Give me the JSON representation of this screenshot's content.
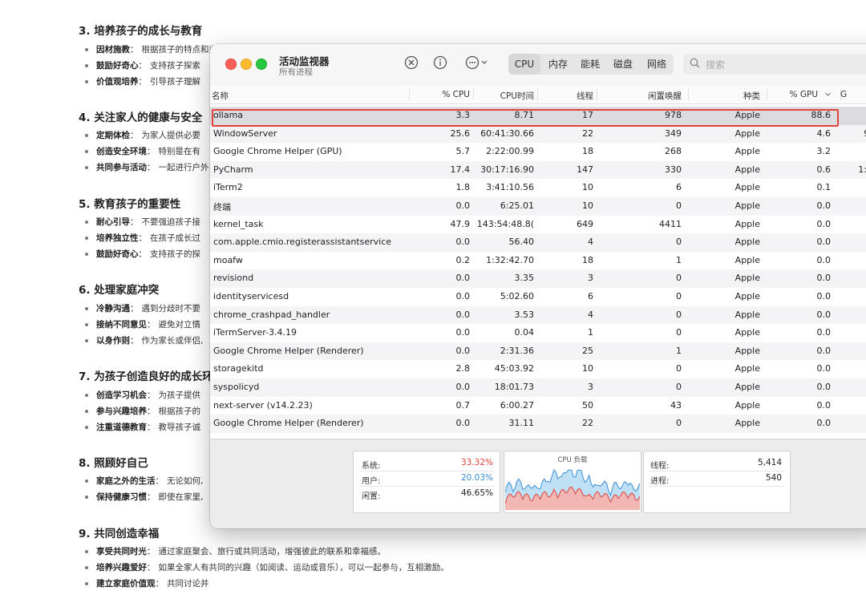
{
  "document": {
    "sections": [
      {
        "title": "3. 培养孩子的成长与教育",
        "items": [
          {
            "term": "因材施教",
            "text": "根据孩子的特点和兴趣因材施教，制定个性化的教育计划。"
          },
          {
            "term": "鼓励好奇心",
            "text": "支持孩子探索"
          },
          {
            "term": "价值观培养",
            "text": "引导孩子理解"
          }
        ]
      },
      {
        "title": "4. 关注家人的健康与安全",
        "items": [
          {
            "term": "定期体检",
            "text": "为家人提供必要"
          },
          {
            "term": "创造安全环境",
            "text": "特别是在有"
          },
          {
            "term": "共同参与活动",
            "text": "一起进行户外"
          }
        ]
      },
      {
        "title": "5. 教育孩子的重要性",
        "items": [
          {
            "term": "耐心引导",
            "text": "不要强迫孩子接"
          },
          {
            "term": "培养独立性",
            "text": "在孩子成长过"
          },
          {
            "term": "鼓励好奇心",
            "text": "支持孩子的探"
          }
        ]
      },
      {
        "title": "6. 处理家庭冲突",
        "items": [
          {
            "term": "冷静沟通",
            "text": "遇到分歧时不要"
          },
          {
            "term": "接纳不同意见",
            "text": "避免对立情"
          },
          {
            "term": "以身作则",
            "text": "作为家长或伴侣,"
          }
        ]
      },
      {
        "title": "7. 为孩子创造良好的成长环",
        "items": [
          {
            "term": "创造学习机会",
            "text": "为孩子提供"
          },
          {
            "term": "参与兴趣培养",
            "text": "根据孩子的"
          },
          {
            "term": "注重道德教育",
            "text": "教导孩子诚"
          }
        ]
      },
      {
        "title": "8. 照顾好自己",
        "items": [
          {
            "term": "家庭之外的生活",
            "text": "无论如何,"
          },
          {
            "term": "保持健康习惯",
            "text": "即使在家里,"
          }
        ]
      },
      {
        "title": "9. 共同创造幸福",
        "items": [
          {
            "term": "享受共同时光",
            "text": "通过家庭聚会、旅行或共同活动，增强彼此的联系和幸福感。"
          },
          {
            "term": "培养兴趣爱好",
            "text": "如果全家人有共同的兴趣（如阅读、运动或音乐），可以一起参与，互相激励。"
          },
          {
            "term": "建立家庭价值观",
            "text": "共同讨论并"
          }
        ]
      }
    ]
  },
  "window": {
    "title": "活动监视器",
    "subtitle": "所有进程",
    "toolbar_icons": [
      "close-circle-icon",
      "info-icon",
      "more-icon"
    ],
    "tabs": [
      "CPU",
      "内存",
      "能耗",
      "磁盘",
      "网络"
    ],
    "active_tab": "CPU",
    "search_placeholder": "搜索",
    "columns": [
      "名称",
      "% CPU",
      "CPU时间",
      "线程",
      "闲置唤醒",
      "种类",
      "% GPU",
      "G"
    ],
    "sort_indicator": "chevron-down-icon",
    "rows": [
      {
        "name": "ollama",
        "cpu": "3.3",
        "time": "8.71",
        "threads": "17",
        "wakeups": "978",
        "kind": "Apple",
        "gpu": "88.6",
        "gtime": ""
      },
      {
        "name": "WindowServer",
        "cpu": "25.6",
        "time": "60:41:30.66",
        "threads": "22",
        "wakeups": "349",
        "kind": "Apple",
        "gpu": "4.6",
        "gtime": "9:"
      },
      {
        "name": "Google Chrome Helper (GPU)",
        "cpu": "5.7",
        "time": "2:22:00.99",
        "threads": "18",
        "wakeups": "268",
        "kind": "Apple",
        "gpu": "3.2",
        "gtime": "3"
      },
      {
        "name": "PyCharm",
        "cpu": "17.4",
        "time": "30:17:16.90",
        "threads": "147",
        "wakeups": "330",
        "kind": "Apple",
        "gpu": "0.6",
        "gtime": "1:3"
      },
      {
        "name": "iTerm2",
        "cpu": "1.8",
        "time": "3:41:10.56",
        "threads": "10",
        "wakeups": "6",
        "kind": "Apple",
        "gpu": "0.1",
        "gtime": ""
      },
      {
        "name": "终端",
        "cpu": "0.0",
        "time": "6:25.01",
        "threads": "10",
        "wakeups": "0",
        "kind": "Apple",
        "gpu": "0.0",
        "gtime": ""
      },
      {
        "name": "kernel_task",
        "cpu": "47.9",
        "time": "143:54:48.8(",
        "threads": "649",
        "wakeups": "4411",
        "kind": "Apple",
        "gpu": "0.0",
        "gtime": ""
      },
      {
        "name": "com.apple.cmio.registerassistantservice",
        "cpu": "0.0",
        "time": "56.40",
        "threads": "4",
        "wakeups": "0",
        "kind": "Apple",
        "gpu": "0.0",
        "gtime": ""
      },
      {
        "name": "moafw",
        "cpu": "0.2",
        "time": "1:32:42.70",
        "threads": "18",
        "wakeups": "1",
        "kind": "Apple",
        "gpu": "0.0",
        "gtime": ""
      },
      {
        "name": "revisiond",
        "cpu": "0.0",
        "time": "3.35",
        "threads": "3",
        "wakeups": "0",
        "kind": "Apple",
        "gpu": "0.0",
        "gtime": ""
      },
      {
        "name": "identityservicesd",
        "cpu": "0.0",
        "time": "5:02.60",
        "threads": "6",
        "wakeups": "0",
        "kind": "Apple",
        "gpu": "0.0",
        "gtime": ""
      },
      {
        "name": "chrome_crashpad_handler",
        "cpu": "0.0",
        "time": "3.53",
        "threads": "4",
        "wakeups": "0",
        "kind": "Apple",
        "gpu": "0.0",
        "gtime": ""
      },
      {
        "name": "iTermServer-3.4.19",
        "cpu": "0.0",
        "time": "0.04",
        "threads": "1",
        "wakeups": "0",
        "kind": "Apple",
        "gpu": "0.0",
        "gtime": ""
      },
      {
        "name": "Google Chrome Helper (Renderer)",
        "cpu": "0.0",
        "time": "2:31.36",
        "threads": "25",
        "wakeups": "1",
        "kind": "Apple",
        "gpu": "0.0",
        "gtime": ""
      },
      {
        "name": "storagekitd",
        "cpu": "2.8",
        "time": "45:03.92",
        "threads": "10",
        "wakeups": "0",
        "kind": "Apple",
        "gpu": "0.0",
        "gtime": ""
      },
      {
        "name": "syspolicyd",
        "cpu": "0.0",
        "time": "18:01.73",
        "threads": "3",
        "wakeups": "0",
        "kind": "Apple",
        "gpu": "0.0",
        "gtime": ""
      },
      {
        "name": "next-server (v14.2.23)",
        "cpu": "0.7",
        "time": "6:00.27",
        "threads": "50",
        "wakeups": "43",
        "kind": "Apple",
        "gpu": "0.0",
        "gtime": ""
      },
      {
        "name": "Google Chrome Helper (Renderer)",
        "cpu": "0.0",
        "time": "31.11",
        "threads": "22",
        "wakeups": "0",
        "kind": "Apple",
        "gpu": "0.0",
        "gtime": ""
      }
    ],
    "summary": {
      "system_label": "系统:",
      "system_value": "33.32%",
      "user_label": "用户:",
      "user_value": "20.03%",
      "idle_label": "闲置:",
      "idle_value": "46.65%",
      "chart_title": "CPU 负载",
      "threads_label": "线程:",
      "threads_value": "5,414",
      "processes_label": "进程:",
      "processes_value": "540"
    },
    "colors": {
      "system": "#e0433b",
      "user": "#3b8fd9",
      "highlight": "#e0433b"
    }
  }
}
